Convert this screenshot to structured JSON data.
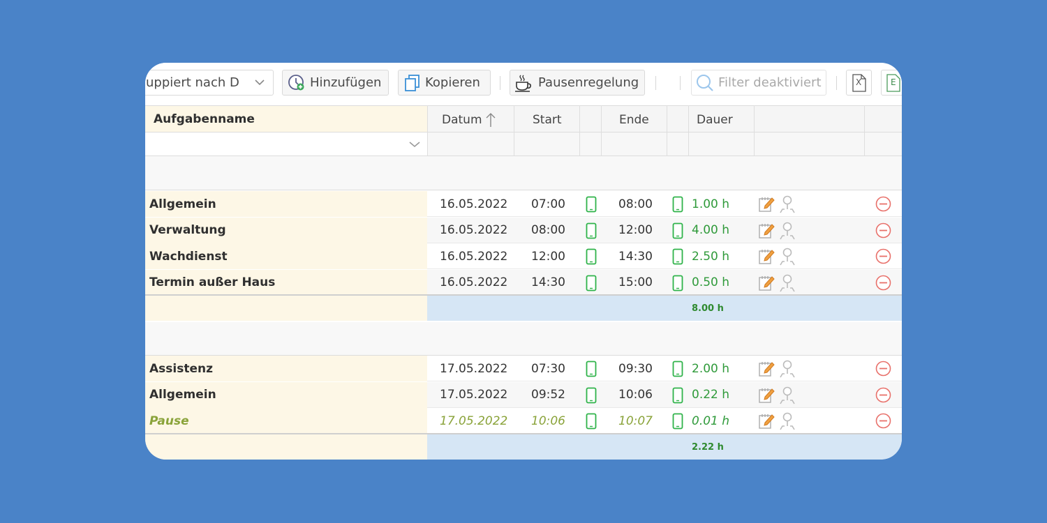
{
  "toolbar": {
    "group_select": "uppiert nach D",
    "add_label": "Hinzufügen",
    "copy_label": "Kopieren",
    "pause_label": "Pausenregelung",
    "filter_placeholder": "Filter deaktiviert",
    "export_xls_letter": "X",
    "export_e_letter": "E"
  },
  "columns": {
    "name": "Aufgabenname",
    "date": "Datum",
    "start": "Start",
    "end": "Ende",
    "duration": "Dauer"
  },
  "groups": [
    {
      "total": "8.00 h",
      "rows": [
        {
          "name": "Allgemein",
          "date": "16.05.2022",
          "start": "07:00",
          "end": "08:00",
          "duration": "1.00 h"
        },
        {
          "name": "Verwaltung",
          "date": "16.05.2022",
          "start": "08:00",
          "end": "12:00",
          "duration": "4.00 h"
        },
        {
          "name": "Wachdienst",
          "date": "16.05.2022",
          "start": "12:00",
          "end": "14:30",
          "duration": "2.50 h"
        },
        {
          "name": "Termin außer Haus",
          "date": "16.05.2022",
          "start": "14:30",
          "end": "15:00",
          "duration": "0.50 h"
        }
      ]
    },
    {
      "total": "2.22 h",
      "rows": [
        {
          "name": "Assistenz",
          "date": "17.05.2022",
          "start": "07:30",
          "end": "09:30",
          "duration": "2.00 h"
        },
        {
          "name": "Allgemein",
          "date": "17.05.2022",
          "start": "09:52",
          "end": "10:06",
          "duration": "0.22 h"
        },
        {
          "name": "Pause",
          "date": "17.05.2022",
          "start": "10:06",
          "end": "10:07",
          "duration": "0.01 h",
          "is_pause": true
        }
      ]
    }
  ],
  "colors": {
    "background": "#4a83c8",
    "name_column": "#fdf7e6",
    "summary_row": "#d6e6f5",
    "duration_green": "#2f9a3a",
    "pause_text": "#8aa33a",
    "delete_red": "#e8706a"
  },
  "icons": {
    "add": "clock-plus-icon",
    "copy": "copy-icon",
    "pause": "coffee-cup-icon",
    "filter": "search-icon",
    "xls": "excel-file-icon",
    "e_export": "e-file-icon",
    "device": "mobile-phone-icon",
    "edit": "edit-note-icon",
    "user": "user-assign-icon",
    "delete": "minus-circle-icon"
  }
}
